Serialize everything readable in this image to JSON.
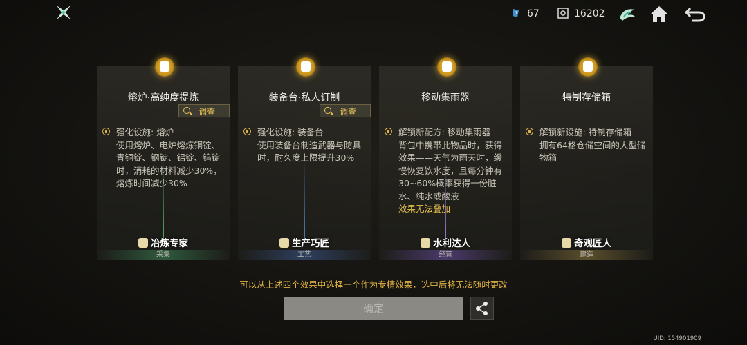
{
  "topbar": {
    "logo_icon": "shuriken-logo-icon",
    "resource1": {
      "icon": "crystal-icon",
      "value": "67"
    },
    "resource2": {
      "icon": "target-icon",
      "value": "16202"
    },
    "buttons": [
      {
        "icon": "faction-emblem-icon"
      },
      {
        "icon": "home-icon"
      },
      {
        "icon": "back-arrow-icon"
      }
    ]
  },
  "cards": [
    {
      "title": "熔炉·高纯度提炼",
      "has_inspect": true,
      "inspect_label": "调查",
      "bullet_label": "强化设施: 熔炉",
      "desc": "使用熔炉、电炉熔炼铜锭、青铜锭、钢锭、铝锭、钨锭时，消耗的材料减少30%，熔炼时间减少30%",
      "warning": "",
      "role": "冶炼专家",
      "category": "采集",
      "category_color": "#2f5a3e"
    },
    {
      "title": "装备台·私人订制",
      "has_inspect": true,
      "inspect_label": "调查",
      "bullet_label": "强化设施: 装备台",
      "desc": "使用装备台制造武器与防具时，耐久度上限提升30%",
      "warning": "",
      "role": "生产巧匠",
      "category": "工艺",
      "category_color": "#2e3f5e"
    },
    {
      "title": "移动集雨器",
      "has_inspect": false,
      "inspect_label": "",
      "bullet_label": "解锁新配方: 移动集雨器",
      "desc": "背包中携带此物品时，获得效果——天气为雨天时，缓慢恢复饮水度，且每分钟有30~60%概率获得一份脏水、纯水或酸液",
      "warning": "效果无法叠加",
      "role": "水利达人",
      "category": "经营",
      "category_color": "#4a3a6a"
    },
    {
      "title": "特制存储箱",
      "has_inspect": false,
      "inspect_label": "",
      "bullet_label": "解锁新设施: 特制存储箱",
      "desc": "拥有64格仓储空间的大型储物箱",
      "warning": "",
      "role": "奇观匠人",
      "category": "建造",
      "category_color": "#5a4e2c"
    }
  ],
  "hint": "可以从上述四个效果中选择一个作为专精效果，选中后将无法随时更改",
  "confirm_label": "确定",
  "share_icon": "share-icon",
  "uid": "UID: 154901909"
}
